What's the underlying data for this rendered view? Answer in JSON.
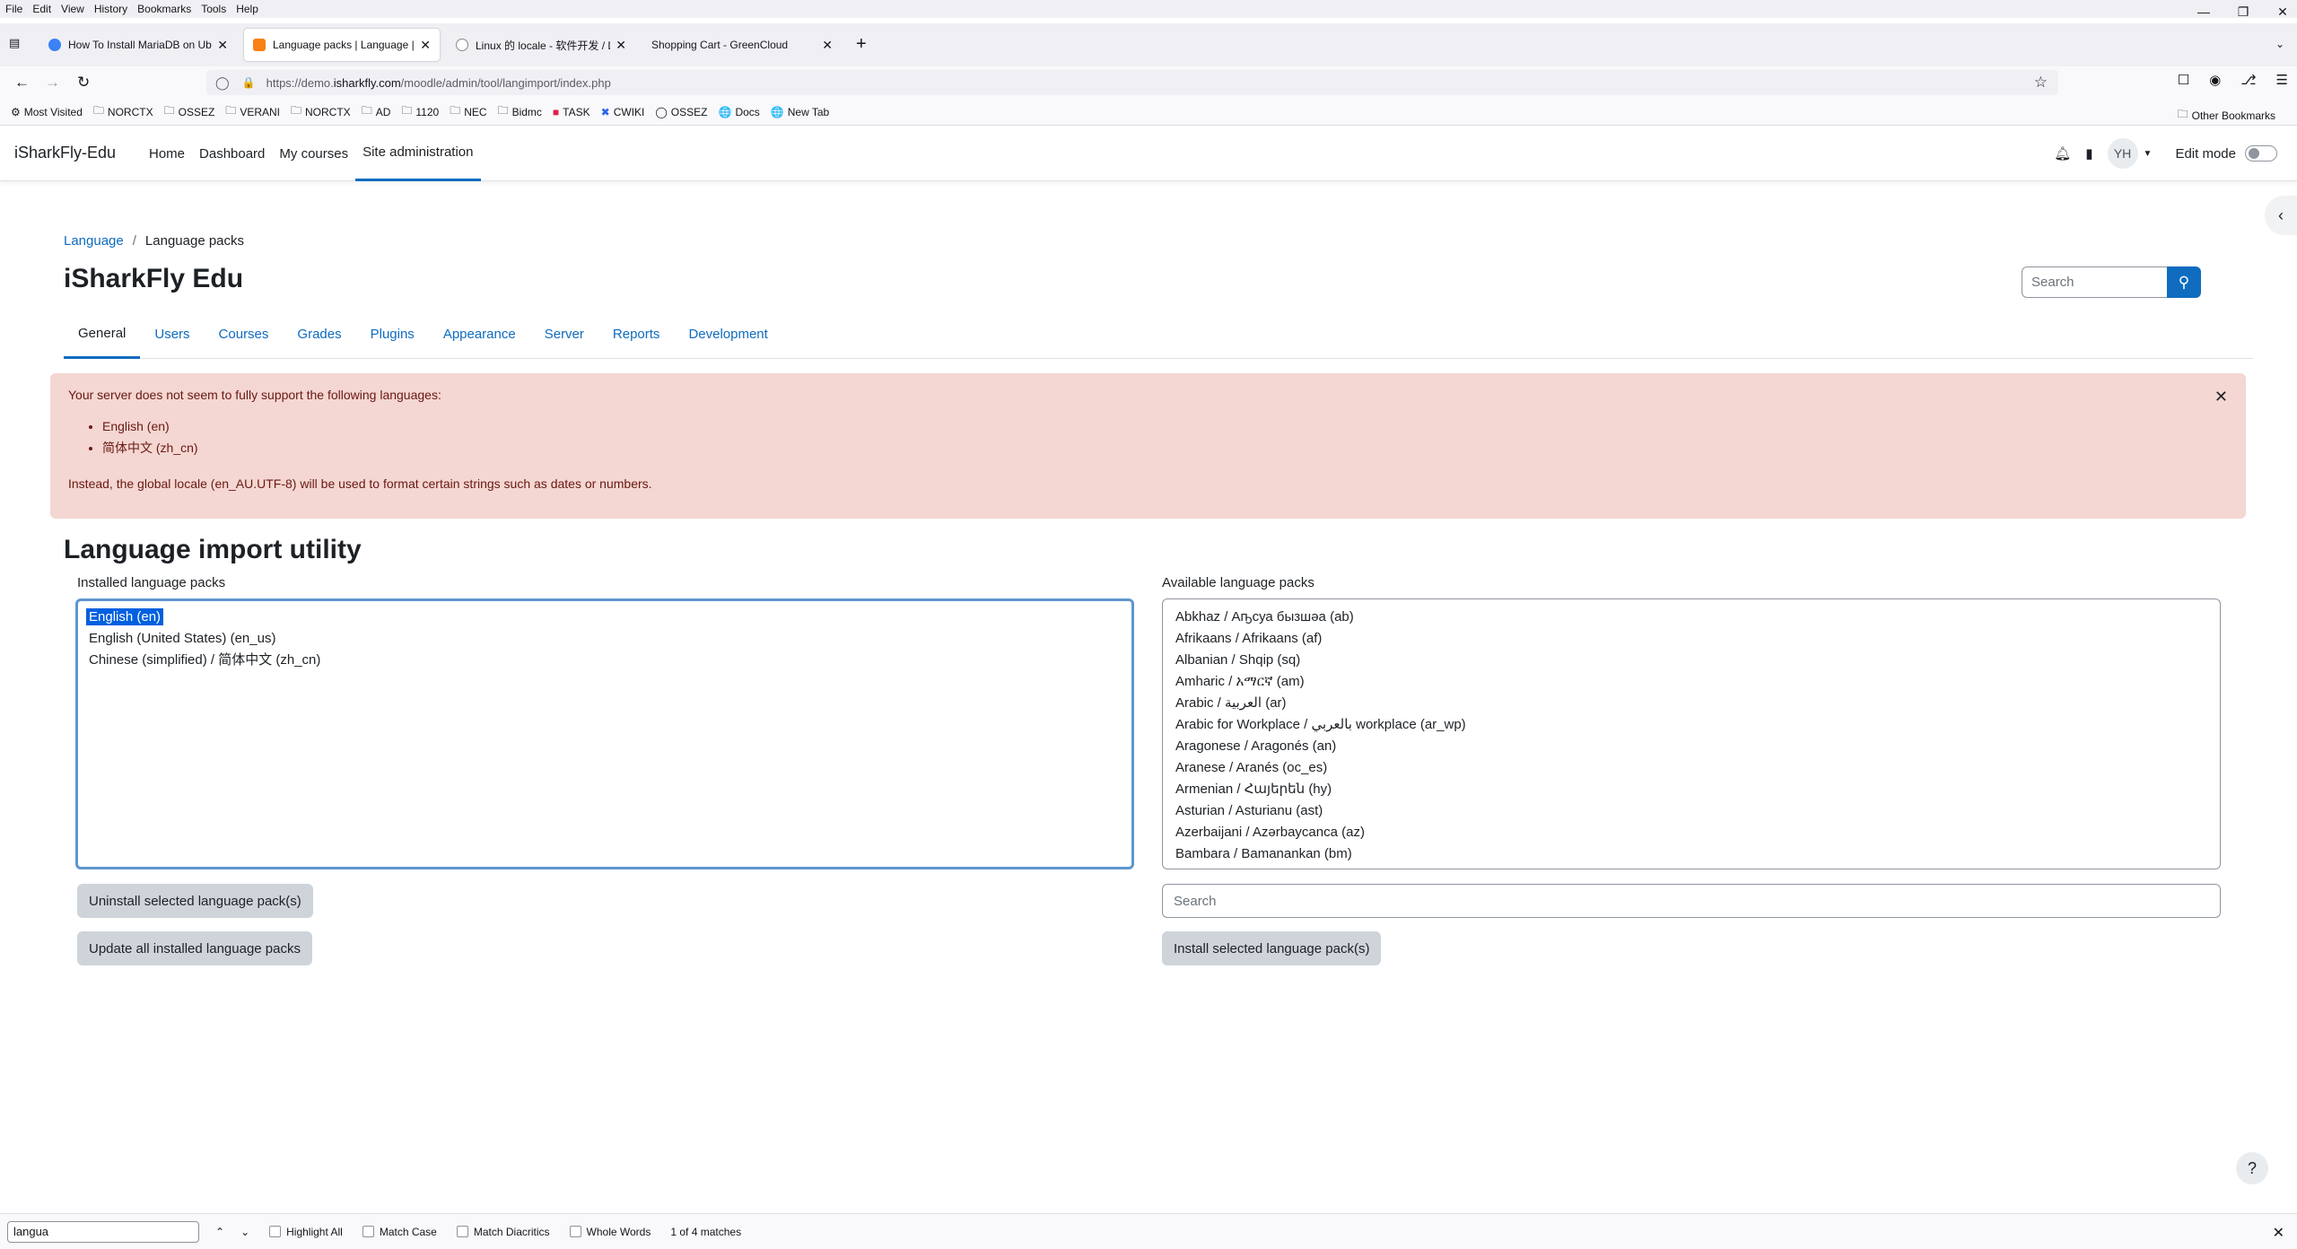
{
  "browser": {
    "menu": [
      "File",
      "Edit",
      "View",
      "History",
      "Bookmarks",
      "Tools",
      "Help"
    ],
    "tabs": [
      {
        "title": "How To Install MariaDB on Ubu",
        "active": false
      },
      {
        "title": "Language packs | Language | A:",
        "active": true
      },
      {
        "title": "Linux 的 locale - 软件开发 / De",
        "active": false
      },
      {
        "title": "Shopping Cart - GreenCloud",
        "active": false
      }
    ],
    "url_prefix": "https://demo.",
    "url_domain": "isharkfly.com",
    "url_path": "/moodle/admin/tool/langimport/index.php",
    "bookmarks": [
      "Most Visited",
      "NORCTX",
      "OSSEZ",
      "VERANI",
      "NORCTX",
      "AD",
      "1120",
      "NEC",
      "Bidmc",
      "TASK",
      "CWIKI",
      "OSSEZ",
      "Docs",
      "New Tab"
    ],
    "other_bookmarks": "Other Bookmarks"
  },
  "moodle": {
    "site_name": "iSharkFly-Edu",
    "primary_nav": [
      "Home",
      "Dashboard",
      "My courses",
      "Site administration"
    ],
    "avatar_initials": "YH",
    "edit_mode_label": "Edit mode",
    "breadcrumb": [
      "Language",
      "Language packs"
    ],
    "page_heading": "iSharkFly Edu",
    "search_placeholder": "Search",
    "secondary_tabs": [
      "General",
      "Users",
      "Courses",
      "Grades",
      "Plugins",
      "Appearance",
      "Server",
      "Reports",
      "Development"
    ],
    "alert": {
      "message": "Your server does not seem to fully support the following languages:",
      "languages": [
        "English (en)",
        "简体中文 (zh_cn)"
      ],
      "footer": "Instead, the global locale (en_AU.UTF-8) will be used to format certain strings such as dates or numbers."
    },
    "utility_heading": "Language import utility",
    "installed": {
      "label": "Installed language packs",
      "items": [
        "English (en)",
        "English (United States) (en_us)",
        "Chinese (simplified) / 简体中文 (zh_cn)"
      ],
      "uninstall_button": "Uninstall selected language pack(s)",
      "update_button": "Update all installed language packs"
    },
    "available": {
      "label": "Available language packs",
      "items": [
        "Abkhaz / Аҧсуа бызшәа (ab)",
        "Afrikaans / Afrikaans (af)",
        "Albanian / Shqip (sq)",
        "Amharic / አማርኛ (am)",
        "Arabic / العربية (ar)",
        "Arabic for Workplace / بالعربي workplace (ar_wp)",
        "Aragonese / Aragonés (an)",
        "Aranese / Aranés (oc_es)",
        "Armenian / Հայերեն (hy)",
        "Asturian / Asturianu (ast)",
        "Azerbaijani / Azərbaycanca (az)",
        "Bambara / Bamanankan (bm)"
      ],
      "search_placeholder": "Search",
      "install_button": "Install selected language pack(s)"
    },
    "help_label": "?"
  },
  "findbar": {
    "query": "langua",
    "options": [
      "Highlight All",
      "Match Case",
      "Match Diacritics",
      "Whole Words"
    ],
    "matches": "1 of 4 matches"
  },
  "colors": {
    "primary": "#0f6cbf",
    "alert_bg": "#f4d6d2",
    "alert_text": "#691911",
    "selection": "#0060df"
  }
}
